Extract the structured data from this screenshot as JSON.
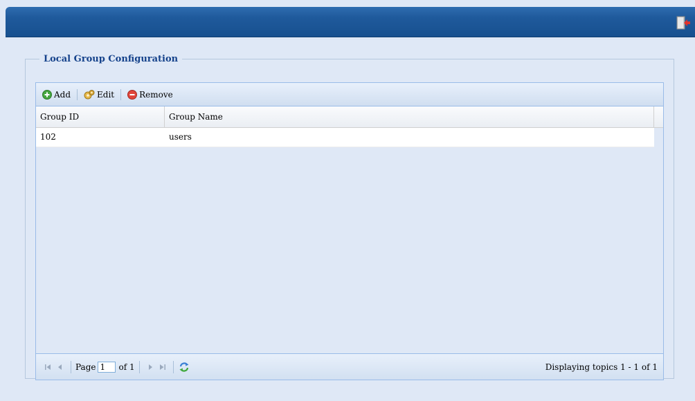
{
  "panel": {
    "legend": "Local Group Configuration"
  },
  "toolbar": {
    "add_label": "Add",
    "edit_label": "Edit",
    "remove_label": "Remove"
  },
  "table": {
    "columns": [
      "Group ID",
      "Group Name"
    ],
    "rows": [
      {
        "group_id": "102",
        "group_name": "users"
      }
    ]
  },
  "pager": {
    "page_label": "Page",
    "page_value": "1",
    "of_label": "of 1",
    "display_text": "Displaying topics 1 - 1 of 1"
  },
  "icons": {
    "logout": "logout-door-icon",
    "add": "add-icon",
    "edit": "edit-gear-icon",
    "remove": "remove-icon",
    "first": "first-page-icon",
    "prev": "prev-page-icon",
    "next": "next-page-icon",
    "last": "last-page-icon",
    "refresh": "refresh-icon"
  },
  "colors": {
    "header_bar": "#1f5a9c",
    "accent": "#15428b",
    "background": "#dfe8f6"
  }
}
